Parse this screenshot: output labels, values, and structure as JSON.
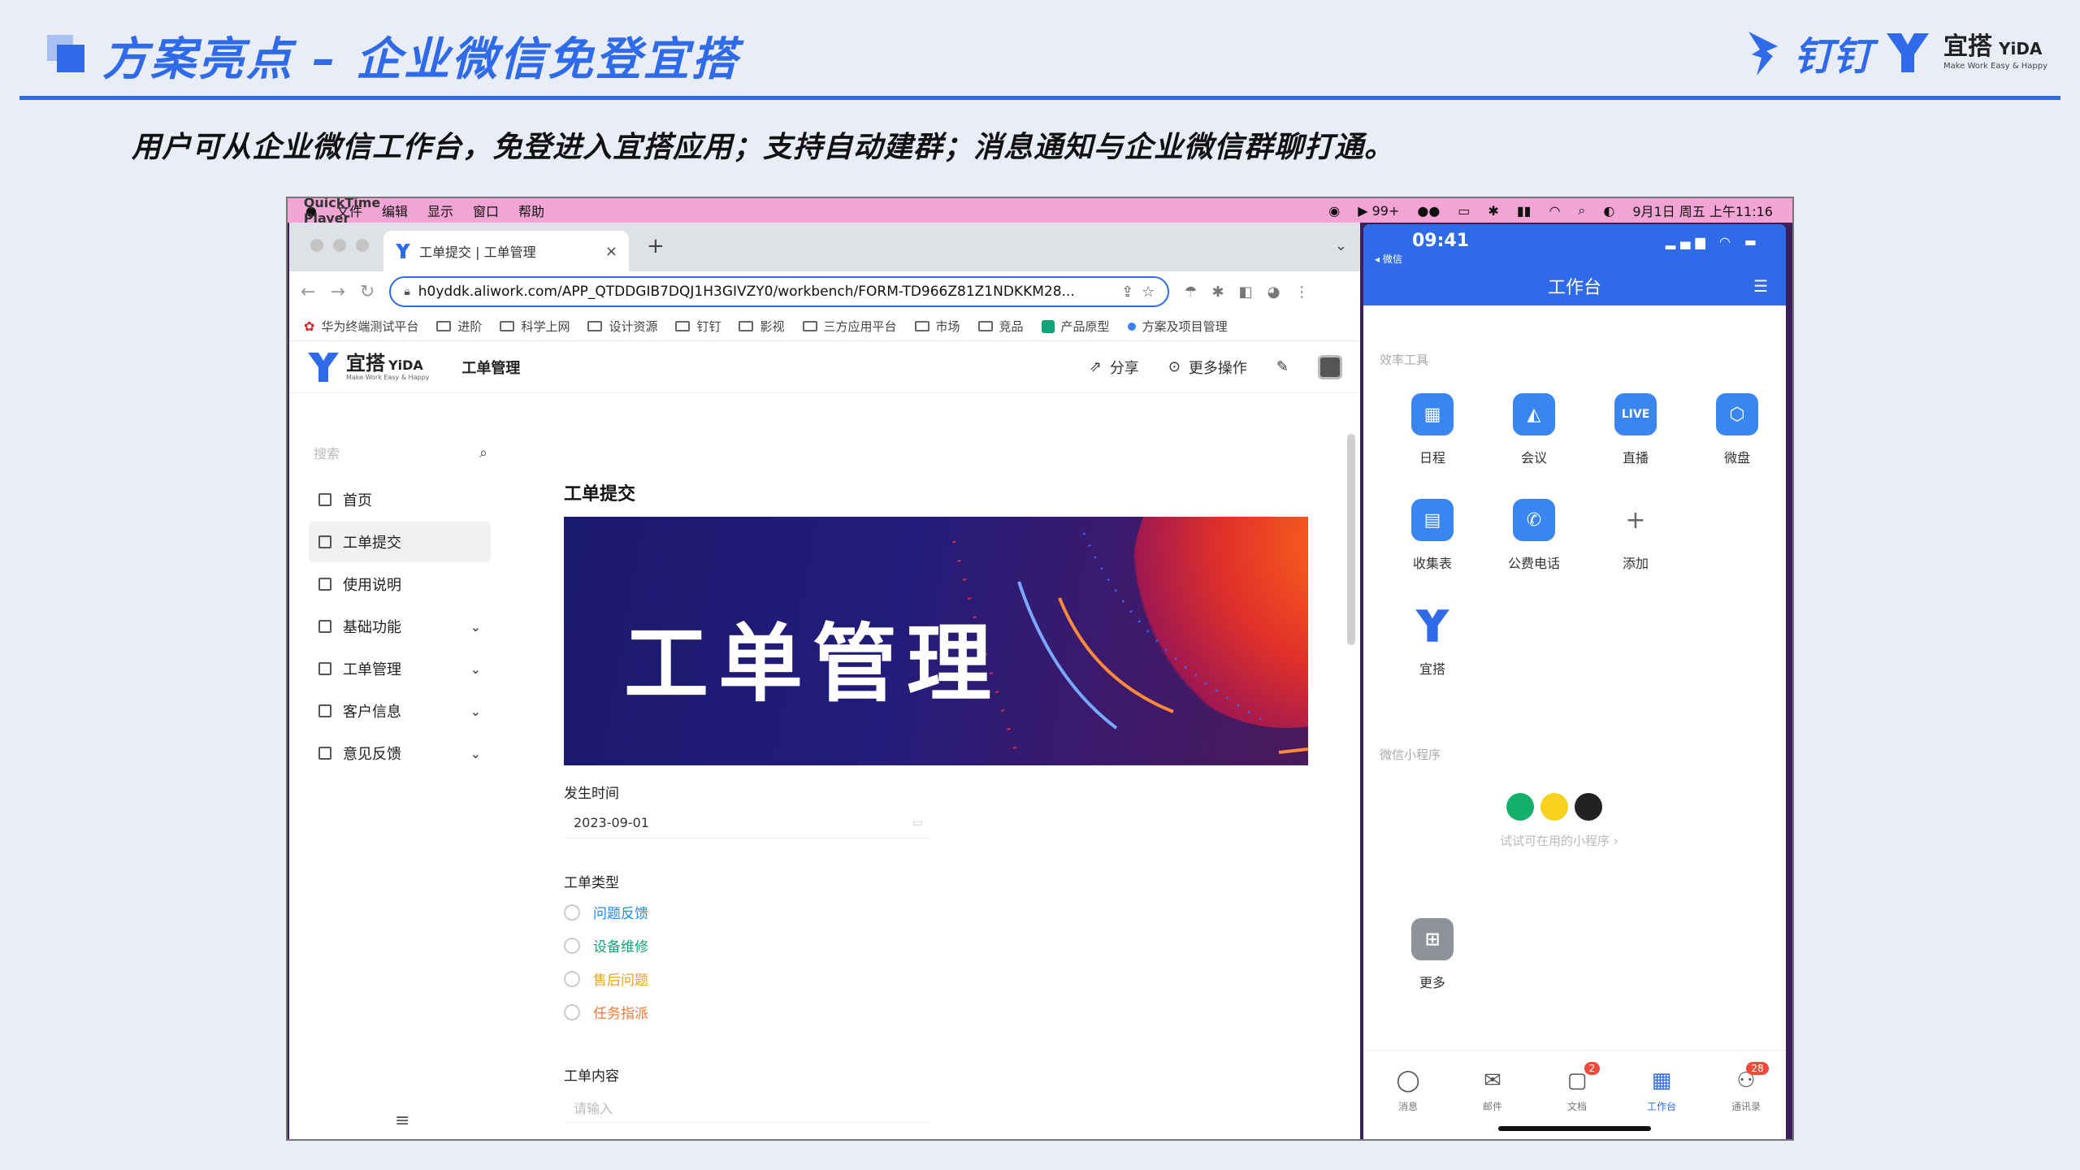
{
  "slide": {
    "title": "方案亮点 – 企业微信免登宜搭",
    "subtitle": "用户可从企业微信工作台，免登进入宜搭应用；支持自动建群；消息通知与企业微信群聊打通。",
    "brand_dingtalk": "钉钉",
    "brand_yida": "宜搭",
    "brand_yida_en": "YiDA",
    "brand_slogan": "Make Work Easy & Happy",
    "accent": "#2f6be8"
  },
  "menubar": {
    "apple": "",
    "app": "QuickTime Player",
    "menus": [
      "文件",
      "编辑",
      "显示",
      "窗口",
      "帮助"
    ],
    "badge_count": "99+",
    "datetime": "9月1日 周五 上午11:16"
  },
  "browser": {
    "tab_title": "工单提交 | 工单管理",
    "close": "×",
    "new_tab": "+",
    "url": "h0yddk.aliwork.com/APP_QTDDGIB7DQJ1H3GIVZY0/workbench/FORM-TD966Z81Z1NDKKM28...",
    "bookmarks": [
      "华为终端测试平台",
      "进阶",
      "科学上网",
      "设计资源",
      "钉钉",
      "影视",
      "三方应用平台",
      "市场",
      "竞品",
      "产品原型",
      "方案及项目管理"
    ]
  },
  "app": {
    "logo": "宜搭",
    "logo_en": "YiDA",
    "logo_sub": "Make Work Easy & Happy",
    "name": "工单管理",
    "share": "分享",
    "more": "更多操作"
  },
  "sidebar": {
    "search_placeholder": "搜索",
    "items": [
      {
        "label": "首页"
      },
      {
        "label": "工单提交"
      },
      {
        "label": "使用说明"
      },
      {
        "label": "基础功能"
      },
      {
        "label": "工单管理"
      },
      {
        "label": "客户信息"
      },
      {
        "label": "意见反馈"
      }
    ]
  },
  "form": {
    "title": "工单提交",
    "banner_text": "工单管理",
    "time_label": "发生时间",
    "time_value": "2023-09-01",
    "type_label": "工单类型",
    "types": [
      {
        "label": "问题反馈",
        "color": "#1d8cf0"
      },
      {
        "label": "设备维修",
        "color": "#12a37a"
      },
      {
        "label": "售后问题",
        "color": "#f0a020"
      },
      {
        "label": "任务指派",
        "color": "#f07a3a"
      }
    ],
    "content_label": "工单内容",
    "content_placeholder": "请输入"
  },
  "phone": {
    "time": "09:41",
    "back": "◂ 微信",
    "title": "工作台",
    "section_tools": "效率工具",
    "tools": [
      {
        "label": "日程",
        "icon": "calendar-icon"
      },
      {
        "label": "会议",
        "icon": "meeting-icon"
      },
      {
        "label": "直播",
        "icon": "live-icon",
        "icon_text": "LIVE"
      },
      {
        "label": "微盘",
        "icon": "drive-icon"
      },
      {
        "label": "收集表",
        "icon": "form-icon"
      },
      {
        "label": "公费电话",
        "icon": "phone-icon"
      },
      {
        "label": "添加",
        "icon": "plus-icon"
      }
    ],
    "yida_label": "宜搭",
    "section_mini": "微信小程序",
    "mini_hint": "试试可在用的小程序 ›",
    "more_label": "更多",
    "tabs": [
      {
        "label": "消息",
        "icon": "message-icon"
      },
      {
        "label": "邮件",
        "icon": "mail-icon"
      },
      {
        "label": "文档",
        "icon": "doc-icon",
        "badge": "2"
      },
      {
        "label": "工作台",
        "icon": "workbench-icon"
      },
      {
        "label": "通讯录",
        "icon": "contacts-icon",
        "badge": "28"
      }
    ]
  }
}
